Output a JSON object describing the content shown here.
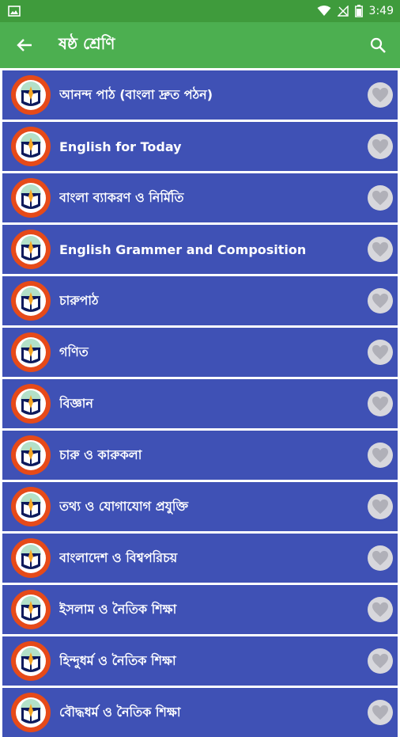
{
  "status": {
    "time": "3:49"
  },
  "appbar": {
    "title": "ষষ্ঠ শ্রেণি"
  },
  "icons": {
    "back": "arrow-back-icon",
    "search": "search-icon",
    "favorite": "heart-icon",
    "logo": "book-logo-icon"
  },
  "colors": {
    "statusbar": "#3f9b3c",
    "appbar": "#4caf50",
    "row": "#3f51b5",
    "heart": "#b0b0b8"
  },
  "books": [
    {
      "title": "আনন্দ পাঠ (বাংলা দ্রুত পঠন)"
    },
    {
      "title": "English for Today"
    },
    {
      "title": "বাংলা ব্যাকরণ ও নির্মিতি"
    },
    {
      "title": "English Grammer and Composition"
    },
    {
      "title": "চারুপাঠ"
    },
    {
      "title": "গণিত"
    },
    {
      "title": "বিজ্ঞান"
    },
    {
      "title": "চারু ও কারুকলা"
    },
    {
      "title": "তথ্য ও যোগাযোগ প্রযুক্তি"
    },
    {
      "title": "বাংলাদেশ ও বিশ্বপরিচয়"
    },
    {
      "title": "ইসলাম ও নৈতিক শিক্ষা"
    },
    {
      "title": "হিন্দুধর্ম ও নৈতিক শিক্ষা"
    },
    {
      "title": "বৌদ্ধধর্ম ও নৈতিক শিক্ষা"
    }
  ]
}
